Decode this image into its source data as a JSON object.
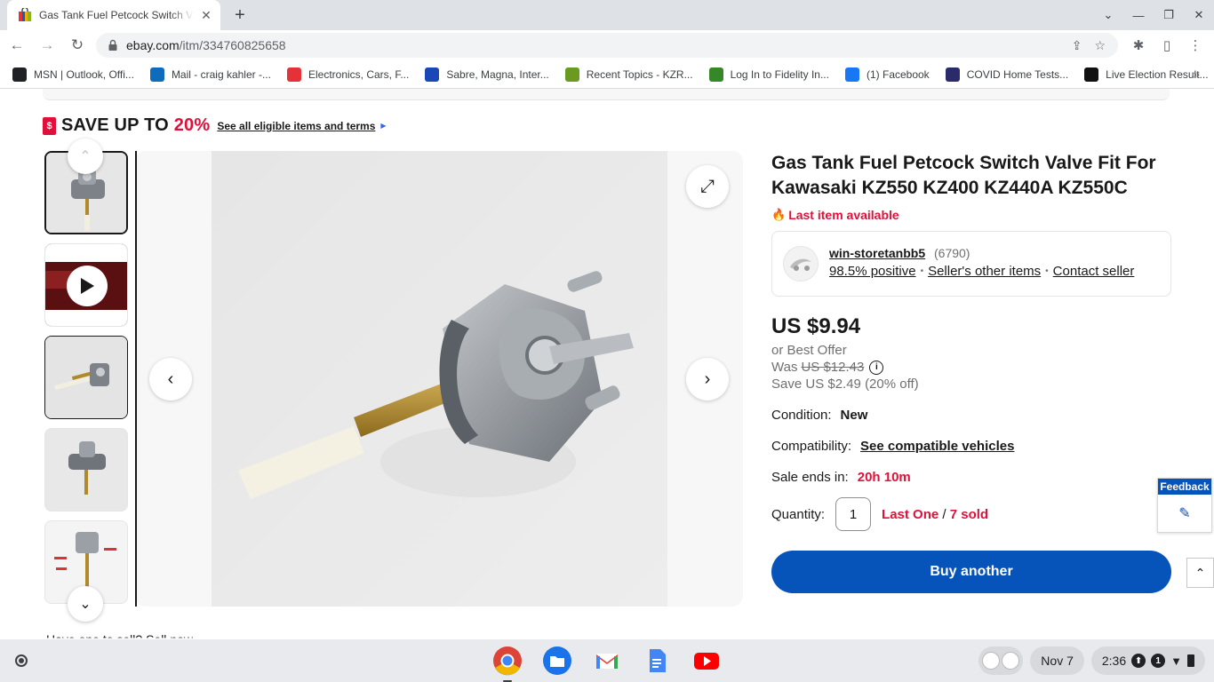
{
  "browser": {
    "tab_title": "Gas Tank Fuel Petcock Switch Valve Fit For Kawasaki KZ550 KZ400 KZ440A KZ550C | eBay",
    "url_domain": "ebay.com",
    "url_path": "/itm/334760825658",
    "bookmarks": [
      {
        "label": "MSN | Outlook, Offi...",
        "icon": "msn-icon",
        "color": "#202124"
      },
      {
        "label": "Mail - craig kahler -...",
        "icon": "outlook-icon",
        "color": "#0f6cbd"
      },
      {
        "label": "Electronics, Cars, F...",
        "icon": "ebay-icon",
        "color": "#e53238"
      },
      {
        "label": "Sabre, Magna, Inter...",
        "icon": "v4-icon",
        "color": "#1a47b8"
      },
      {
        "label": "Recent Topics - KZR...",
        "icon": "kzrider-icon",
        "color": "#6a9a1f"
      },
      {
        "label": "Log In to Fidelity In...",
        "icon": "fidelity-icon",
        "color": "#368727"
      },
      {
        "label": "(1) Facebook",
        "icon": "facebook-icon",
        "color": "#1877f2"
      },
      {
        "label": "COVID Home Tests...",
        "icon": "covid-icon",
        "color": "#2b2a6b"
      },
      {
        "label": "Live Election Result...",
        "icon": "wsj-icon",
        "color": "#111111"
      }
    ]
  },
  "promo": {
    "save_prefix": "SAVE UP TO ",
    "save_pct": "20%",
    "terms_link": "See all eligible items and terms"
  },
  "listing": {
    "title": "Gas Tank Fuel Petcock Switch Valve Fit For Kawasaki KZ550 KZ400 KZ440A KZ550C",
    "urgency": "Last item available",
    "seller": {
      "name": "win-storetanbb5",
      "count": "(6790)",
      "positive": "98.5% positive",
      "other_items": "Seller's other items",
      "contact": "Contact seller"
    },
    "price": "US $9.94",
    "best_offer": "or Best Offer",
    "was_label": "Was",
    "was_price": "US $12.43",
    "savings": "Save US $2.49 (20% off)",
    "condition_label": "Condition:",
    "condition_value": "New",
    "compat_label": "Compatibility:",
    "compat_link": "See compatible vehicles",
    "sale_label": "Sale ends in:",
    "sale_value": "20h 10m",
    "qty_label": "Quantity:",
    "qty_value": "1",
    "qty_last_one": "Last One",
    "qty_sep": " / ",
    "qty_sold": "7 sold",
    "buy_label": "Buy another",
    "cutoff_text": "Have one to sell? Sell now"
  },
  "feedback": {
    "label": "Feedback"
  },
  "shelf": {
    "date": "Nov 7",
    "time": "2:36",
    "notification_count": "1"
  },
  "colors": {
    "accent_red": "#e0103a",
    "buy_blue": "#0654ba"
  }
}
